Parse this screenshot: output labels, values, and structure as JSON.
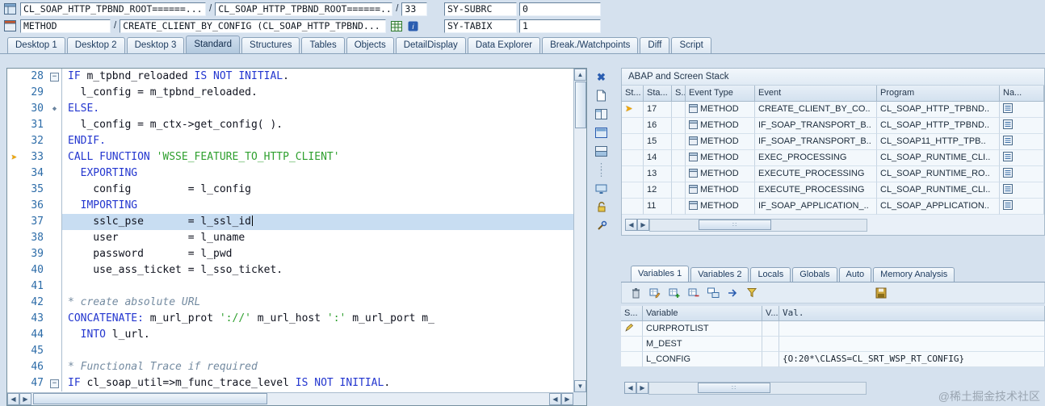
{
  "window": {
    "row1": {
      "main_program": "CL_SOAP_HTTP_TPBND_ROOT======...",
      "source": "CL_SOAP_HTTP_TPBND_ROOT======...",
      "line": "33",
      "separator": "/",
      "sysfield_label": "SY-SUBRC",
      "sysfield_value": "0"
    },
    "row2": {
      "event_type": "METHOD",
      "event": "CREATE_CLIENT_BY_CONFIG (CL_SOAP_HTTP_TPBND...",
      "separator": "/",
      "sysfield_label": "SY-TABIX",
      "sysfield_value": "1"
    }
  },
  "desktop_tabs": {
    "active": "Standard",
    "items": [
      "Desktop 1",
      "Desktop 2",
      "Desktop 3",
      "Standard",
      "Structures",
      "Tables",
      "Objects",
      "DetailDisplay",
      "Data Explorer",
      "Break./Watchpoints",
      "Diff",
      "Script"
    ]
  },
  "editor": {
    "current_line": 33,
    "selected_line": 37,
    "lines": [
      {
        "num": "28",
        "fold": "box",
        "tokens": [
          [
            "k",
            "IF"
          ],
          [
            "t",
            " m_tpbnd_reloaded "
          ],
          [
            "k",
            "IS NOT INITIAL"
          ],
          [
            "t",
            "."
          ]
        ]
      },
      {
        "num": "29",
        "fold": "",
        "tokens": [
          [
            "t",
            "  l_config = m_tpbnd_reloaded."
          ]
        ]
      },
      {
        "num": "30",
        "fold": "dot",
        "tokens": [
          [
            "k",
            "ELSE."
          ]
        ]
      },
      {
        "num": "31",
        "fold": "",
        "tokens": [
          [
            "t",
            "  l_config = m_ctx->get_config( )."
          ]
        ]
      },
      {
        "num": "32",
        "fold": "",
        "tokens": [
          [
            "k",
            "ENDIF."
          ]
        ]
      },
      {
        "num": "33",
        "fold": "",
        "tokens": [
          [
            "k",
            "CALL FUNCTION"
          ],
          [
            "t",
            " "
          ],
          [
            "s",
            "'WSSE_FEATURE_TO_HTTP_CLIENT'"
          ]
        ]
      },
      {
        "num": "34",
        "fold": "",
        "tokens": [
          [
            "k",
            "  EXPORTING"
          ]
        ]
      },
      {
        "num": "35",
        "fold": "",
        "tokens": [
          [
            "t",
            "    config         = l_config"
          ]
        ]
      },
      {
        "num": "36",
        "fold": "",
        "tokens": [
          [
            "k",
            "  IMPORTING"
          ]
        ]
      },
      {
        "num": "37",
        "fold": "",
        "tokens": [
          [
            "t",
            "    sslc_pse       = l_ssl_id"
          ]
        ]
      },
      {
        "num": "38",
        "fold": "",
        "tokens": [
          [
            "t",
            "    user           = l_uname"
          ]
        ]
      },
      {
        "num": "39",
        "fold": "",
        "tokens": [
          [
            "t",
            "    password       = l_pwd"
          ]
        ]
      },
      {
        "num": "40",
        "fold": "",
        "tokens": [
          [
            "t",
            "    use_ass_ticket = l_sso_ticket."
          ]
        ]
      },
      {
        "num": "41",
        "fold": "",
        "tokens": []
      },
      {
        "num": "42",
        "fold": "",
        "tokens": [
          [
            "c",
            "* create absolute URL"
          ]
        ]
      },
      {
        "num": "43",
        "fold": "",
        "tokens": [
          [
            "k",
            "CONCATENATE:"
          ],
          [
            "t",
            " m_url_prot "
          ],
          [
            "s",
            "'://'"
          ],
          [
            "t",
            " m_url_host "
          ],
          [
            "s",
            "':'"
          ],
          [
            "t",
            " m_url_port m_"
          ]
        ]
      },
      {
        "num": "44",
        "fold": "",
        "tokens": [
          [
            "k",
            "  INTO"
          ],
          [
            "t",
            " l_url."
          ]
        ]
      },
      {
        "num": "45",
        "fold": "",
        "tokens": []
      },
      {
        "num": "46",
        "fold": "",
        "tokens": [
          [
            "c",
            "* Functional Trace if required"
          ]
        ]
      },
      {
        "num": "47",
        "fold": "box",
        "tokens": [
          [
            "k",
            "IF"
          ],
          [
            "t",
            " cl_soap_util=>m_func_trace_level "
          ],
          [
            "k",
            "IS NOT INITIAL"
          ],
          [
            "t",
            "."
          ]
        ]
      }
    ]
  },
  "stack": {
    "title": "ABAP and Screen Stack",
    "columns": [
      "St...",
      "Sta...",
      "S..",
      "Event Type",
      "Event",
      "Program",
      "Na..."
    ],
    "rows": [
      {
        "active": true,
        "level": "17",
        "event_type": "METHOD",
        "event": "CREATE_CLIENT_BY_CO..",
        "program": "CL_SOAP_HTTP_TPBND.."
      },
      {
        "active": false,
        "level": "16",
        "event_type": "METHOD",
        "event": "IF_SOAP_TRANSPORT_B..",
        "program": "CL_SOAP_HTTP_TPBND.."
      },
      {
        "active": false,
        "level": "15",
        "event_type": "METHOD",
        "event": "IF_SOAP_TRANSPORT_B..",
        "program": "CL_SOAP11_HTTP_TPB.."
      },
      {
        "active": false,
        "level": "14",
        "event_type": "METHOD",
        "event": "EXEC_PROCESSING",
        "program": "CL_SOAP_RUNTIME_CLI.."
      },
      {
        "active": false,
        "level": "13",
        "event_type": "METHOD",
        "event": "EXECUTE_PROCESSING",
        "program": "CL_SOAP_RUNTIME_RO.."
      },
      {
        "active": false,
        "level": "12",
        "event_type": "METHOD",
        "event": "EXECUTE_PROCESSING",
        "program": "CL_SOAP_RUNTIME_CLI.."
      },
      {
        "active": false,
        "level": "11",
        "event_type": "METHOD",
        "event": "IF_SOAP_APPLICATION_..",
        "program": "CL_SOAP_APPLICATION.."
      }
    ]
  },
  "variables": {
    "tabs": [
      "Variables 1",
      "Variables 2",
      "Locals",
      "Globals",
      "Auto",
      "Memory Analysis"
    ],
    "active_tab": "Variables 1",
    "columns": [
      "S...",
      "Variable",
      "V...",
      "Val."
    ],
    "rows": [
      {
        "icon": "edit",
        "variable": "CURPROTLIST",
        "vflag": "",
        "val": ""
      },
      {
        "icon": "",
        "variable": "M_DEST",
        "vflag": "",
        "val": ""
      },
      {
        "icon": "",
        "variable": "L_CONFIG",
        "vflag": "",
        "val": "{O:20*\\CLASS=CL_SRT_WSP_RT_CONFIG}"
      }
    ]
  },
  "side_toolbar": {
    "icons": [
      "close",
      "new-page",
      "split-screen",
      "full-screen",
      "swap-layout",
      "grip",
      "screen",
      "unlock",
      "tools"
    ]
  },
  "vars_toolbar": {
    "left_icons": [
      "trash",
      "table-edit",
      "table-add",
      "table-remove",
      "tables-compare",
      "goto",
      "filter"
    ],
    "right_icons": [
      "save"
    ]
  },
  "colors": {
    "keyword": "#2336cf",
    "literal": "#2fa02f",
    "comment": "#748ba1",
    "selection": "#c8ddf2",
    "current_arrow": "#f2a600"
  },
  "watermark": "@稀土掘金技术社区"
}
